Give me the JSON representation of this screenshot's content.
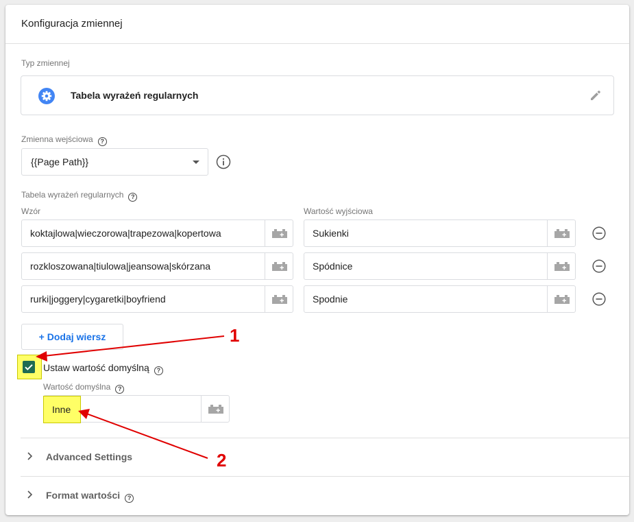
{
  "card": {
    "title": "Konfiguracja zmiennej"
  },
  "variable_type": {
    "label": "Typ zmiennej",
    "icon": "gear-icon",
    "name": "Tabela wyrażeń regularnych"
  },
  "input_variable": {
    "label": "Zmienna wejściowa",
    "value": "{{Page Path}}"
  },
  "regex_table": {
    "label": "Tabela wyrażeń regularnych",
    "pattern_header": "Wzór",
    "output_header": "Wartość wyjściowa",
    "rows": [
      {
        "pattern": "koktajlowa|wieczorowa|trapezowa|kopertowa",
        "output": "Sukienki"
      },
      {
        "pattern": "rozkloszowana|tiulowa|jeansowa|skórzana",
        "output": "Spódnice"
      },
      {
        "pattern": "rurki|joggery|cygaretki|boyfriend",
        "output": "Spodnie"
      }
    ],
    "add_row_label": "+ Dodaj wiersz"
  },
  "default_value": {
    "checkbox_label": "Ustaw wartość domyślną",
    "checked": true,
    "field_label": "Wartość domyślna",
    "value": "Inne"
  },
  "sections": [
    {
      "title": "Advanced Settings"
    },
    {
      "title": "Format wartości"
    }
  ],
  "annotations": [
    "1",
    "2"
  ],
  "colors": {
    "accent_blue": "#1a73e8",
    "gear_blue": "#4285f4",
    "checkbox_green": "#1e6b52",
    "highlight_yellow": "#ffff66",
    "annotation_red": "#e00000"
  }
}
